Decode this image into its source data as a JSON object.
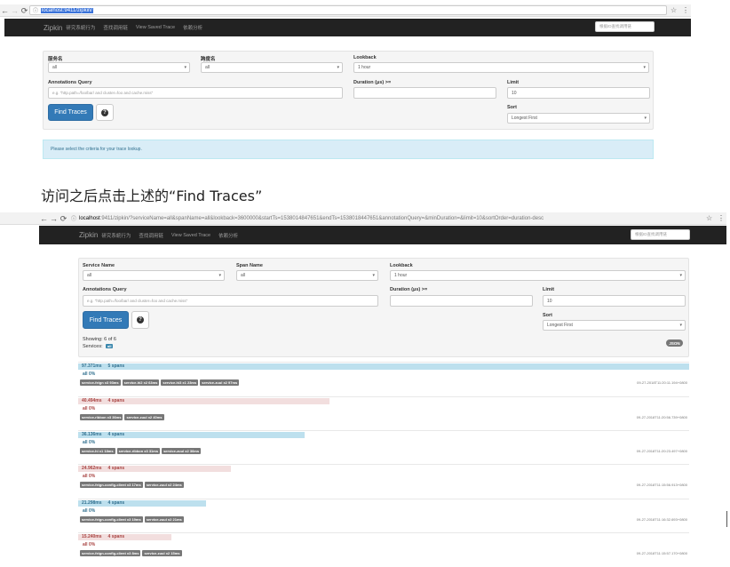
{
  "top": {
    "browser": {
      "url": "localhost:9411/zipkin/"
    },
    "navbar": {
      "brand": "Zipkin",
      "links": [
        "研究系統行为",
        "查找调用链",
        "View Saved Trace",
        "依赖分析"
      ],
      "search_placeholder": "根据ID查找调用链"
    },
    "form": {
      "service_label": "服务名",
      "service_value": "all",
      "span_label": "跨度名",
      "span_value": "all",
      "lookback_label": "Lookback",
      "lookback_value": "1 hour",
      "annotations_label": "Annotations Query",
      "annotations_placeholder": "e.g. \"http.path=/foo/bar/ and cluster=foo and cache.miss\"",
      "duration_label": "Duration (μs) >=",
      "limit_label": "Limit",
      "limit_value": "10",
      "sort_label": "Sort",
      "sort_value": "Longest First",
      "find_button": "Find Traces",
      "help_icon": "?"
    },
    "alert": "Please select the criteria for your trace lookup."
  },
  "caption": "访问之后点击上述的“Find Traces”",
  "bottom": {
    "browser": {
      "url_host": "localhost",
      "url_rest": ":9411/zipkin/?serviceName=all&spanName=all&lookback=3600000&startTs=1538014847651&endTs=1538018447651&annotationQuery=&minDuration=&limit=10&sortOrder=duration-desc"
    },
    "navbar": {
      "brand": "Zipkin",
      "links": [
        "研究系統行为",
        "查找调用链",
        "View Saved Trace",
        "依赖分析"
      ],
      "search_placeholder": "根据ID查找调用链"
    },
    "form": {
      "service_label": "Service Name",
      "service_value": "all",
      "span_label": "Span Name",
      "span_value": "all",
      "lookback_label": "Lookback",
      "lookback_value": "1 hour",
      "annotations_label": "Annotations Query",
      "annotations_placeholder": "e.g. \"http.path=/foo/bar/ and cluster=foo and cache.miss\"",
      "duration_label": "Duration (μs) >=",
      "limit_label": "Limit",
      "limit_value": "10",
      "sort_label": "Sort",
      "sort_value": "Longest First",
      "find_button": "Find Traces",
      "help_icon": "?"
    },
    "results": {
      "showing": "Showing: 6 of 6",
      "services_label": "Services:",
      "services_badge": "all",
      "json_button": "JSON",
      "traces": [
        {
          "duration": "97.371ms",
          "spans": "5 spans",
          "pct": "all 0%",
          "color": "blue",
          "width_fraction": 1.0,
          "tags": [
            "service-feign x3 93ms",
            "service-hi2 x2 63ms",
            "service-hi3 x1 23ms",
            "service-zuul x2 97ms"
          ],
          "time": "09-27-2018T11:20:11.194+0800"
        },
        {
          "duration": "40.494ms",
          "spans": "4 spans",
          "pct": "all 0%",
          "color": "red",
          "width_fraction": 0.411,
          "tags": [
            "service-ribbon x3 36ms",
            "service-zuul x2 40ms"
          ],
          "time": "09-27-2018T11:20:56.739+0800"
        },
        {
          "duration": "36.136ms",
          "spans": "4 spans",
          "pct": "all 0%",
          "color": "blue",
          "width_fraction": 0.371,
          "tags": [
            "service-hi x1 18ms",
            "service-ribbon x3 31ms",
            "service-zuul x2 36ms"
          ],
          "time": "09-27-2018T11:20:23.497+0800"
        },
        {
          "duration": "24.962ms",
          "spans": "4 spans",
          "pct": "all 0%",
          "color": "red",
          "width_fraction": 0.25,
          "tags": [
            "service-feign-config-client x3 17ms",
            "service-zuul x2 24ms"
          ],
          "time": "09-27-2018T11:15:56.913+0800"
        },
        {
          "duration": "21.298ms",
          "spans": "4 spans",
          "pct": "all 0%",
          "color": "blue",
          "width_fraction": 0.21,
          "tags": [
            "service-feign-config-client x3 19ms",
            "service-zuul x2 21ms"
          ],
          "time": "09-27-2018T11:16:32.693+0800"
        },
        {
          "duration": "15.240ms",
          "spans": "4 spans",
          "pct": "all 0%",
          "color": "red",
          "width_fraction": 0.152,
          "tags": [
            "service-feign-config-client x3 8ms",
            "service-zuul x2 15ms"
          ],
          "time": "09-27-2018T11:15:57.170+0800"
        }
      ]
    }
  }
}
